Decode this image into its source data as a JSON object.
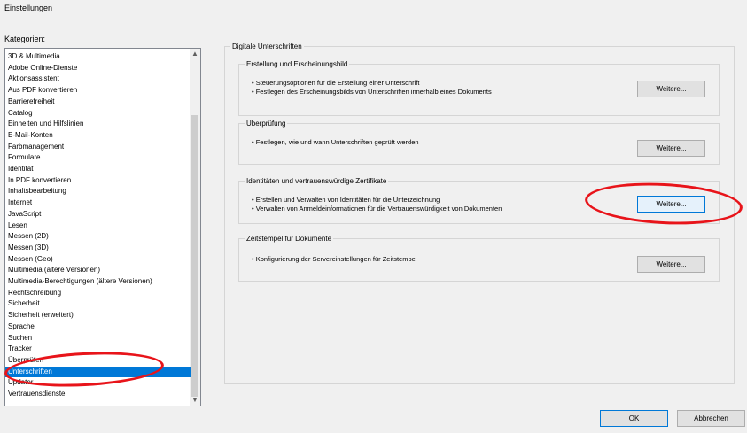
{
  "window": {
    "title": "Einstellungen"
  },
  "categories": {
    "label": "Kategorien:",
    "items": [
      "3D & Multimedia",
      "Adobe Online-Dienste",
      "Aktionsassistent",
      "Aus PDF konvertieren",
      "Barrierefreiheit",
      "Catalog",
      "Einheiten und Hilfslinien",
      "E-Mail-Konten",
      "Farbmanagement",
      "Formulare",
      "Identität",
      "In PDF konvertieren",
      "Inhaltsbearbeitung",
      "Internet",
      "JavaScript",
      "Lesen",
      "Messen (2D)",
      "Messen (3D)",
      "Messen (Geo)",
      "Multimedia (ältere Versionen)",
      "Multimedia-Berechtigungen (ältere Versionen)",
      "Rechtschreibung",
      "Sicherheit",
      "Sicherheit (erweitert)",
      "Sprache",
      "Suchen",
      "Tracker",
      "Überprüfen",
      "Unterschriften",
      "Updater",
      "Vertrauensdienste"
    ],
    "selected": "Unterschriften",
    "scroll_up_icon": "▲",
    "scroll_down_icon": "▼"
  },
  "panel": {
    "title": "Digitale Unterschriften",
    "sections": [
      {
        "title": "Erstellung und Erscheinungsbild",
        "bullets": [
          "• Steuerungsoptionen für die Erstellung einer Unterschrift",
          "• Festlegen des Erscheinungsbilds von Unterschriften innerhalb eines Dokuments"
        ],
        "button": "Weitere..."
      },
      {
        "title": "Überprüfung",
        "bullets": [
          "• Festlegen, wie und wann Unterschriften geprüft werden"
        ],
        "button": "Weitere..."
      },
      {
        "title": "Identitäten und vertrauenswürdige Zertifikate",
        "bullets": [
          "• Erstellen und Verwalten von Identitäten für die Unterzeichnung",
          "• Verwalten von Anmeldeinformationen für die Vertrauenswürdigkeit von Dokumenten"
        ],
        "button": "Weitere..."
      },
      {
        "title": "Zeitstempel für Dokumente",
        "bullets": [
          "• Konfigurierung der Servereinstellungen für Zeitstempel"
        ],
        "button": "Weitere..."
      }
    ]
  },
  "footer": {
    "ok": "OK",
    "cancel": "Abbrechen"
  },
  "colors": {
    "selection": "#0078d7",
    "annotation": "#e8141a"
  }
}
